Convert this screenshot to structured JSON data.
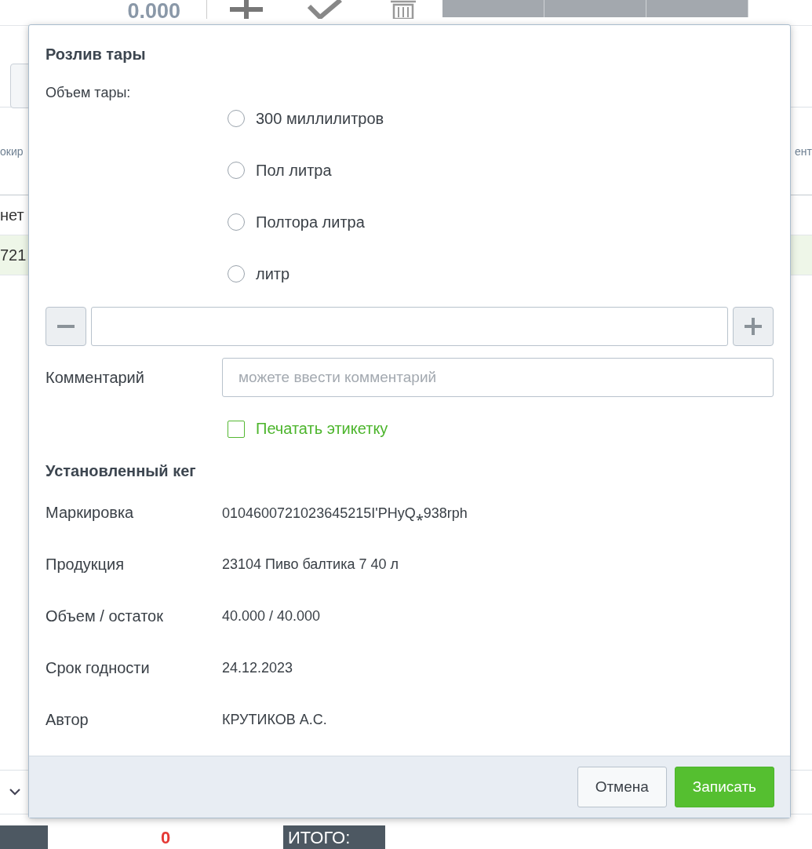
{
  "background": {
    "total_value": "0.000",
    "column_headers": [
      "окир",
      "ент"
    ],
    "cells": [
      "нет",
      "721"
    ],
    "bottom_value": "0",
    "bottom_label": "ИТОГО:"
  },
  "dialog": {
    "title": "Розлив тары",
    "volume_label": "Объем тары:",
    "volume_options": [
      {
        "label": "300 миллилитров",
        "selected": false
      },
      {
        "label": "Пол литра",
        "selected": false
      },
      {
        "label": "Полтора литра",
        "selected": false
      },
      {
        "label": "литр",
        "selected": false
      }
    ],
    "comment": {
      "label": "Комментарий",
      "placeholder": "можете ввести комментарий"
    },
    "print_label": {
      "label": "Печатать этикетку",
      "checked": false
    },
    "keg_title": "Установленный кег",
    "keg_fields": [
      {
        "label": "Маркировка",
        "value": "0104600721023645215I'PHyQ⁎938rph"
      },
      {
        "label": "Продукция",
        "value": "23104 Пиво балтика 7 40 л"
      },
      {
        "label": "Объем / остаток",
        "value": "40.000 / 40.000"
      },
      {
        "label": "Срок годности",
        "value": "24.12.2023"
      },
      {
        "label": "Автор",
        "value": "КРУТИКОВ А.С."
      }
    ],
    "buttons": {
      "cancel": "Отмена",
      "save": "Записать"
    }
  }
}
